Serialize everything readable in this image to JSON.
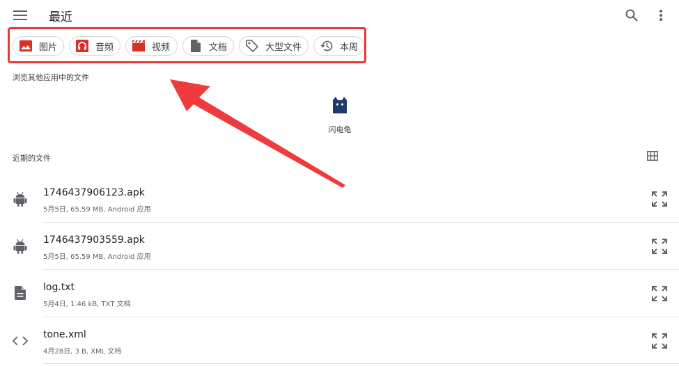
{
  "header": {
    "title": "最近"
  },
  "chips": [
    {
      "label": "图片",
      "icon": "image-icon"
    },
    {
      "label": "音频",
      "icon": "headphones-icon"
    },
    {
      "label": "视频",
      "icon": "clapperboard-icon"
    },
    {
      "label": "文档",
      "icon": "document-icon"
    },
    {
      "label": "大型文件",
      "icon": "tag-icon"
    },
    {
      "label": "本周",
      "icon": "history-icon"
    }
  ],
  "browse": {
    "label": "浏览其他应用中的文件",
    "apps": [
      {
        "name": "闪电龟",
        "icon": "cat-app-icon"
      }
    ]
  },
  "recent": {
    "label": "近期的文件",
    "files": [
      {
        "name": "1746437906123.apk",
        "meta": "5月5日, 65.59 MB, Android 应用",
        "icon": "android-icon"
      },
      {
        "name": "1746437903559.apk",
        "meta": "5月5日, 65.59 MB, Android 应用",
        "icon": "android-icon"
      },
      {
        "name": "log.txt",
        "meta": "5月4日, 1.46 kB, TXT 文档",
        "icon": "text-file-icon"
      },
      {
        "name": "tone.xml",
        "meta": "4月28日, 3 B, XML 文档",
        "icon": "code-icon"
      }
    ]
  },
  "colors": {
    "highlight": "#e53935",
    "chip_icon": "#d93025",
    "arrow": "#ef3b3b",
    "app_icon": "#1f3a6e"
  }
}
